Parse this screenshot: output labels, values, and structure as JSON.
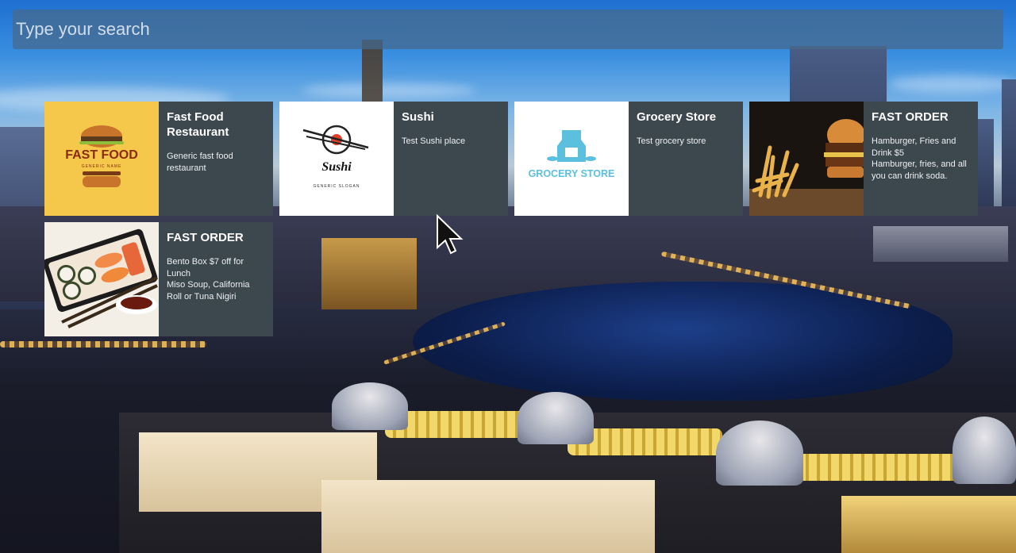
{
  "search": {
    "placeholder": "Type your search",
    "value": ""
  },
  "cards": [
    {
      "title": "Fast Food Restaurant",
      "description": "Generic fast food restaurant",
      "logo": {
        "line1": "FAST FOOD",
        "line2": "GENERIC NAME",
        "icon": "burger-icon",
        "bg": "#f5c84b"
      }
    },
    {
      "title": "Sushi",
      "description": "Test Sushi place",
      "logo": {
        "line1": "Sushi",
        "line2": "GENERIC SLOGAN",
        "icon": "sushi-chopsticks-icon"
      }
    },
    {
      "title": "Grocery Store",
      "description": "Test grocery store",
      "logo": {
        "line1": "GROCERY STORE",
        "icon": "milk-carton-icon",
        "color": "#5bc0de"
      }
    },
    {
      "title": "FAST ORDER",
      "description": "Hamburger, Fries and Drink $5",
      "description2": "Hamburger, fries, and all you can drink soda.",
      "photo": "burger-fries-photo"
    },
    {
      "title": "FAST ORDER",
      "description": "Bento Box  $7 off for Lunch",
      "description2": "Miso Soup, California Roll or Tuna Nigiri",
      "photo": "bento-box-photo"
    }
  ],
  "colors": {
    "card_panel": "#3c474e",
    "search_bg": "#46698c"
  }
}
